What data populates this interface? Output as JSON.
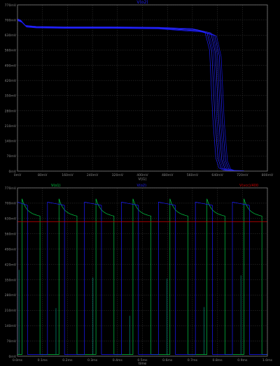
{
  "chart_data": [
    {
      "type": "line",
      "title": "V(o2)",
      "xlabel": "V(i1)",
      "xlim": [
        0,
        800
      ],
      "ylim": [
        0,
        770
      ],
      "x_ticks": [
        "0mV",
        "80mV",
        "160mV",
        "240mV",
        "320mV",
        "400mV",
        "480mV",
        "560mV",
        "640mV",
        "720mV",
        "800mV"
      ],
      "x_tick_values": [
        0,
        80,
        160,
        240,
        320,
        400,
        480,
        560,
        640,
        720,
        800
      ],
      "y_ticks": [
        "0mV",
        "70mV",
        "140mV",
        "210mV",
        "280mV",
        "350mV",
        "420mV",
        "490mV",
        "560mV",
        "630mV",
        "700mV",
        "770mV"
      ],
      "y_tick_values": [
        0,
        70,
        140,
        210,
        280,
        350,
        420,
        490,
        560,
        630,
        700,
        770
      ],
      "grid": true,
      "colors": {
        "background": "#000000",
        "grid": "#3a3a3a",
        "axis": "#808080",
        "text": "#8a8a8a",
        "title": "#2222ff"
      },
      "series": [
        {
          "color": "#1a1aff",
          "x": [
            0,
            10,
            25,
            60,
            150,
            300,
            450,
            560,
            600,
            615,
            625,
            635,
            645,
            660,
            700
          ],
          "y": [
            705,
            700,
            675,
            670,
            668,
            668,
            666,
            660,
            645,
            560,
            250,
            60,
            15,
            4,
            2
          ]
        },
        {
          "color": "#2b2bff",
          "x": [
            0,
            12,
            28,
            60,
            150,
            300,
            450,
            565,
            607,
            622,
            632,
            642,
            652,
            668,
            700
          ],
          "y": [
            700,
            694,
            670,
            666,
            664,
            664,
            662,
            656,
            640,
            555,
            245,
            58,
            14,
            4,
            2
          ]
        },
        {
          "color": "#1010dd",
          "x": [
            0,
            15,
            30,
            60,
            150,
            300,
            450,
            570,
            613,
            628,
            638,
            648,
            658,
            672,
            705
          ],
          "y": [
            698,
            690,
            668,
            664,
            662,
            662,
            660,
            652,
            636,
            550,
            240,
            55,
            13,
            4,
            2
          ]
        },
        {
          "color": "#3030ff",
          "x": [
            0,
            10,
            26,
            60,
            150,
            300,
            450,
            575,
            619,
            634,
            644,
            654,
            664,
            678,
            710
          ],
          "y": [
            703,
            697,
            672,
            668,
            666,
            666,
            664,
            655,
            640,
            545,
            238,
            52,
            12,
            3,
            2
          ]
        },
        {
          "color": "#1c1cf0",
          "x": [
            0,
            13,
            30,
            60,
            150,
            300,
            450,
            580,
            625,
            640,
            650,
            660,
            670,
            684,
            715
          ],
          "y": [
            699,
            692,
            669,
            665,
            663,
            663,
            661,
            650,
            634,
            540,
            232,
            50,
            12,
            3,
            2
          ]
        },
        {
          "color": "#2424ff",
          "x": [
            0,
            11,
            27,
            60,
            150,
            300,
            450,
            585,
            631,
            646,
            656,
            666,
            676,
            690,
            720
          ],
          "y": [
            701,
            695,
            671,
            667,
            665,
            665,
            663,
            648,
            630,
            535,
            228,
            48,
            11,
            3,
            2
          ]
        },
        {
          "color": "#1414e8",
          "x": [
            0,
            14,
            29,
            60,
            150,
            300,
            450,
            590,
            637,
            652,
            662,
            672,
            682,
            695,
            725
          ],
          "y": [
            697,
            689,
            667,
            663,
            661,
            661,
            659,
            644,
            626,
            530,
            224,
            46,
            10,
            3,
            2
          ]
        }
      ]
    },
    {
      "type": "line",
      "title": "V(o2)",
      "xlabel": "time",
      "xlim": [
        0,
        1.0
      ],
      "ylim": [
        0,
        770
      ],
      "x_ticks": [
        "0.0ms",
        "0.1ms",
        "0.2ms",
        "0.3ms",
        "0.4ms",
        "0.5ms",
        "0.6ms",
        "0.7ms",
        "0.8ms",
        "0.9ms",
        "1.0ms"
      ],
      "x_tick_values": [
        0,
        0.1,
        0.2,
        0.3,
        0.4,
        0.5,
        0.6,
        0.7,
        0.8,
        0.9,
        1.0
      ],
      "y_ticks": [
        "0mV",
        "70mV",
        "140mV",
        "210mV",
        "280mV",
        "350mV",
        "420mV",
        "490mV",
        "560mV",
        "630mV",
        "700mV",
        "770mV"
      ],
      "y_tick_values": [
        0,
        70,
        140,
        210,
        280,
        350,
        420,
        490,
        560,
        630,
        700,
        770
      ],
      "grid": true,
      "legend": [
        "V(o1)",
        "V(o2)",
        "V(vcc)/400"
      ],
      "legend_placement": "top",
      "colors": {
        "background": "#000000",
        "grid": "#3a3a3a",
        "axis": "#808080",
        "text": "#8a8a8a"
      },
      "period_ms": 0.148,
      "series": [
        {
          "name": "V(o1)",
          "color": "#00cc44",
          "shape": "relaxation",
          "rise_times_ms": [
            0.018,
            0.166,
            0.314,
            0.462,
            0.61,
            0.758,
            0.906
          ],
          "fall_times_ms": [
            0.09,
            0.238,
            0.386,
            0.534,
            0.682,
            0.83,
            0.978
          ],
          "high_mV": 655,
          "peak_mV": 720,
          "low_mV": 8,
          "spike_mV": [
            395,
            220,
            360,
            185,
            355,
            225,
            370
          ]
        },
        {
          "name": "V(o2)",
          "color": "#1a1aff",
          "shape": "relaxation",
          "rise_times_ms": [
            0.0,
            0.12,
            0.268,
            0.416,
            0.564,
            0.712,
            0.86
          ],
          "fall_times_ms": [
            0.04,
            0.188,
            0.336,
            0.484,
            0.632,
            0.78,
            0.928
          ],
          "high_mV": 705,
          "peak_mV": 705,
          "low_mV": 8
        },
        {
          "name": "V(vcc)/400",
          "color": "#cc0000",
          "shape": "flat",
          "value_mV": 615
        }
      ]
    }
  ]
}
